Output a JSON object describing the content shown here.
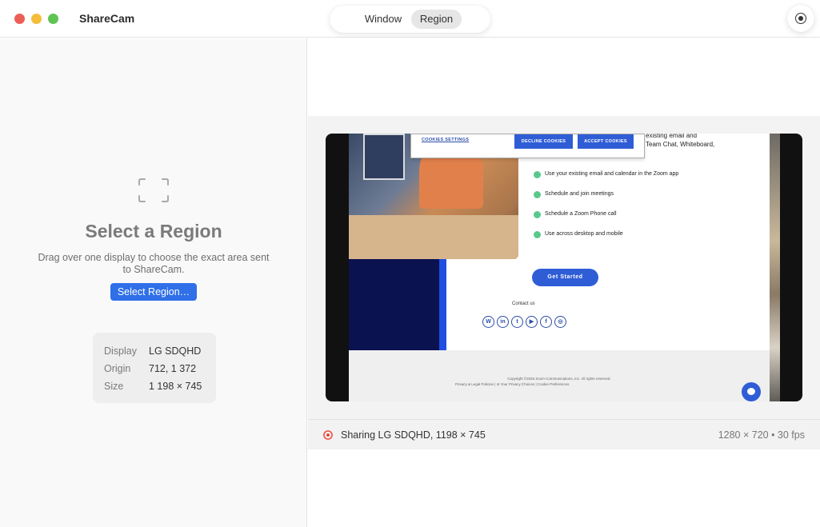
{
  "app": {
    "title": "ShareCam"
  },
  "mode_switch": {
    "window_label": "Window",
    "region_label": "Region",
    "selected": "Region"
  },
  "left_panel": {
    "title": "Select a Region",
    "description": "Drag over one display to choose the exact area sent to ShareCam.",
    "select_button": "Select Region…",
    "info": [
      {
        "key": "Display",
        "value": "LG SDQHD"
      },
      {
        "key": "Origin",
        "value": "712, 1 372"
      },
      {
        "key": "Size",
        "value": "1 198 × 745"
      }
    ]
  },
  "status": {
    "text": "Sharing LG SDQHD, 1198 × 745",
    "resolution": "1280 × 720 • 30 fps",
    "indicator_color": "#d8463a"
  },
  "preview_page": {
    "cookie_settings": "COOKIES SETTINGS",
    "decline": "DECLINE COOKIES",
    "accept": "ACCEPT COOKIES",
    "heading_line1": "existing email and",
    "heading_line2": "Team Chat, Whiteboard,",
    "features": [
      "Use your existing email and calendar in the Zoom app",
      "Schedule and join meetings",
      "Schedule a Zoom Phone call",
      "Use across desktop and mobile"
    ],
    "cta": "Get Started",
    "contact": "Contact us",
    "social_icons": [
      "W",
      "in",
      "t",
      "▶",
      "f",
      "◎"
    ],
    "copyright": "Copyright ©2026 Zoom Communications, Inc. All rights reserved.",
    "footer_links": "Privacy & Legal Policies  |  ⊘ Your Privacy Choices  |  Cookie Preferences"
  },
  "colors": {
    "accent": "#2f6fe8",
    "zoom_blue": "#2f5dd6",
    "navy": "#0a1250"
  }
}
